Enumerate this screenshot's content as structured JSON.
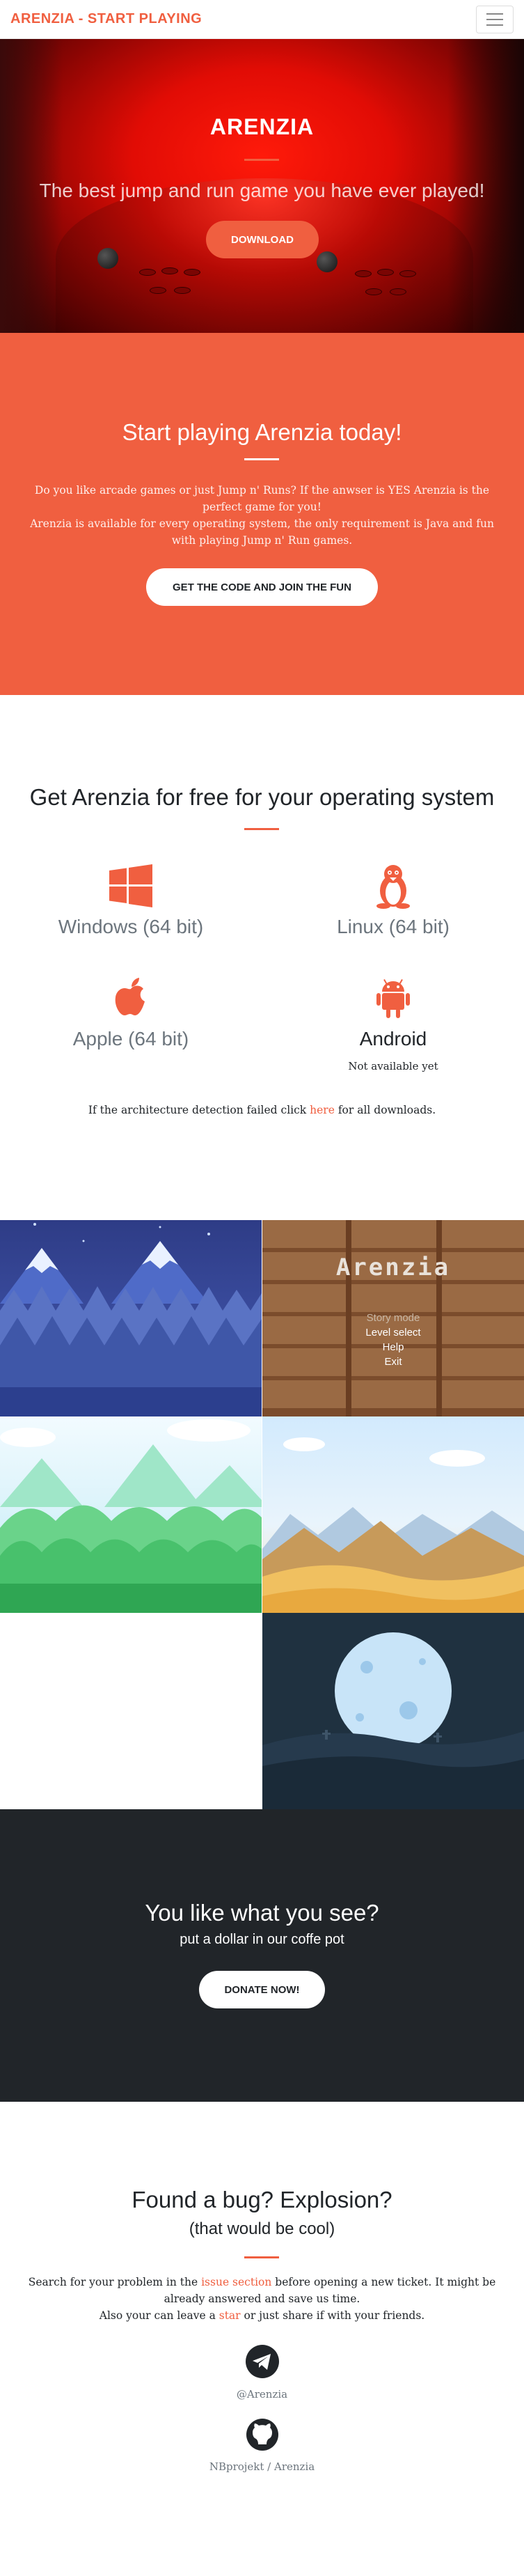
{
  "nav": {
    "brand": "ARENZIA - START PLAYING"
  },
  "hero": {
    "title": "ARENZIA",
    "subtitle": "The best jump and run game you have ever played!",
    "button": "DOWNLOAD"
  },
  "about": {
    "title": "Start playing Arenzia today!",
    "text_1": "Do you like arcade games or just Jump n' Runs? If the anwser is YES Arenzia is the perfect game for you!",
    "text_2": "Arenzia is available for every operating system, the only requirement is Java and fun with playing Jump n' Run games.",
    "button": "GET THE CODE AND JOIN THE FUN"
  },
  "downloads": {
    "title": "Get Arenzia for free for your operating system",
    "os": [
      {
        "name": "Windows (64 bit)",
        "icon": "windows-icon"
      },
      {
        "name": "Linux (64 bit)",
        "icon": "linux-icon"
      },
      {
        "name": "Apple (64 bit)",
        "icon": "apple-icon"
      },
      {
        "name": "Android",
        "icon": "android-icon",
        "note": "Not available yet"
      }
    ],
    "fallback_pre": "If the architecture detection failed click ",
    "fallback_link": "here",
    "fallback_post": " for all downloads."
  },
  "portfolio": {
    "menu_title": "Arenzia",
    "menu_items": [
      "Story mode",
      "Level select",
      "Help",
      "Exit"
    ]
  },
  "donate": {
    "title": "You like what you see?",
    "subtitle": "put a dollar in our coffe pot",
    "button": "DONATE NOW!"
  },
  "contact": {
    "title": "Found a bug? Explosion?",
    "subtitle": "(that would be cool)",
    "line1_pre": "Search for your problem in the ",
    "line1_link": "issue section",
    "line1_post": " before opening a new ticket. It might be already answered and save us time.",
    "line2_pre": "Also your can leave a ",
    "line2_link": "star",
    "line2_post": " or just share if with your friends.",
    "telegram": "@Arenzia",
    "github": "NBprojekt / Arenzia"
  },
  "colors": {
    "primary": "#f05f40",
    "dark": "#212529",
    "muted": "#6c757d"
  }
}
